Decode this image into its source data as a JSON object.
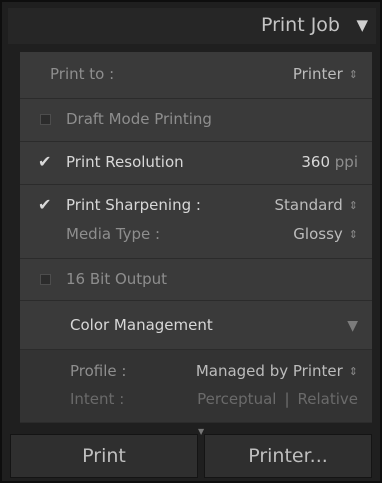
{
  "header": {
    "title": "Print Job",
    "collapse_icon": "triangle-down-icon"
  },
  "print_to": {
    "label": "Print to :",
    "value": "Printer"
  },
  "draft_mode": {
    "label": "Draft Mode Printing",
    "checked": false
  },
  "print_resolution": {
    "label": "Print Resolution",
    "value": "360",
    "unit": "ppi",
    "checked": true
  },
  "print_sharpening": {
    "label": "Print Sharpening :",
    "value": "Standard",
    "checked": true,
    "media_type_label": "Media Type :",
    "media_type_value": "Glossy"
  },
  "bit_output": {
    "label": "16 Bit Output",
    "checked": false
  },
  "color_management": {
    "title": "Color Management",
    "profile_label": "Profile :",
    "profile_value": "Managed by Printer",
    "intent_label": "Intent :",
    "intent_perceptual": "Perceptual",
    "intent_relative": "Relative"
  },
  "buttons": {
    "print": "Print",
    "printer": "Printer..."
  }
}
